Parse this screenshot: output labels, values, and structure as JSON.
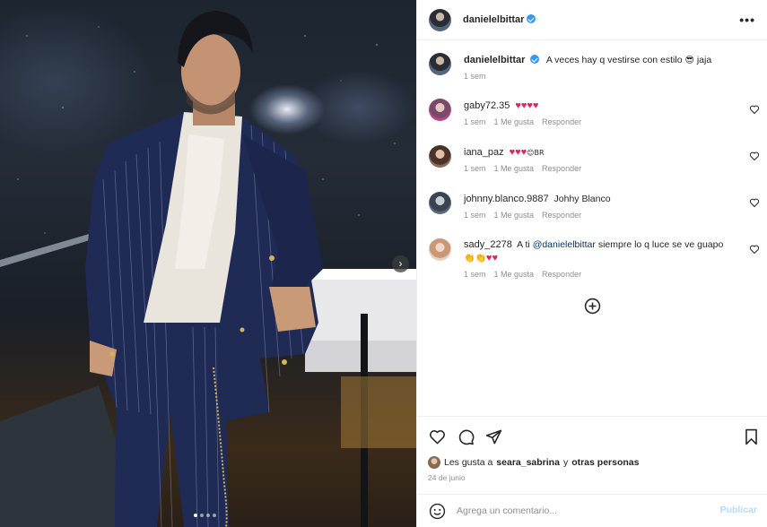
{
  "post": {
    "owner": "danielelbittar",
    "owner_verified": true,
    "caption_user": "danielelbittar",
    "caption_text": "A veces hay q vestirse con estilo",
    "caption_emoji": "😎",
    "caption_suffix": "jaja",
    "caption_time": "1 sem",
    "carousel_dots": 4,
    "carousel_active": 0
  },
  "comments": [
    {
      "user": "gaby72.35",
      "text": "",
      "hearts": "♥♥♥♥",
      "time": "1 sem",
      "likes": "1 Me gusta",
      "reply": "Responder"
    },
    {
      "user": "iana_paz",
      "text": "",
      "hearts": "♥♥♥",
      "extra": "😊BR",
      "time": "1 sem",
      "likes": "1 Me gusta",
      "reply": "Responder"
    },
    {
      "user": "johnny.blanco.9887",
      "text": "Johhy Blanco",
      "time": "1 sem",
      "likes": "1 Me gusta",
      "reply": "Responder"
    },
    {
      "user": "sady_2278",
      "text_pre": "A ti",
      "mention": "@danielelbittar",
      "text_post": "siempre lo q luce se ve guapo",
      "line2_emoji": "👏👏",
      "line2_hearts": "♥♥",
      "time": "1 sem",
      "likes": "1 Me gusta",
      "reply": "Responder"
    }
  ],
  "likes_summary": {
    "prefix": "Les gusta a",
    "user": "seara_sabrina",
    "connector": "y",
    "others": "otras personas"
  },
  "date": "24 de junio",
  "add_comment": {
    "placeholder": "Agrega un comentario...",
    "publish_label": "Publicar"
  },
  "colors": {
    "verified": "#3897f0",
    "heart_red": "#e0245e",
    "link_blue": "#00376b",
    "publish_disabled": "#b3dbff",
    "suit_navy": "#1f2a55"
  },
  "icons": [
    "more-options-icon",
    "heart-icon",
    "comment-icon",
    "share-icon",
    "bookmark-icon",
    "load-more-icon",
    "emoji-icon",
    "next-arrow-icon"
  ]
}
